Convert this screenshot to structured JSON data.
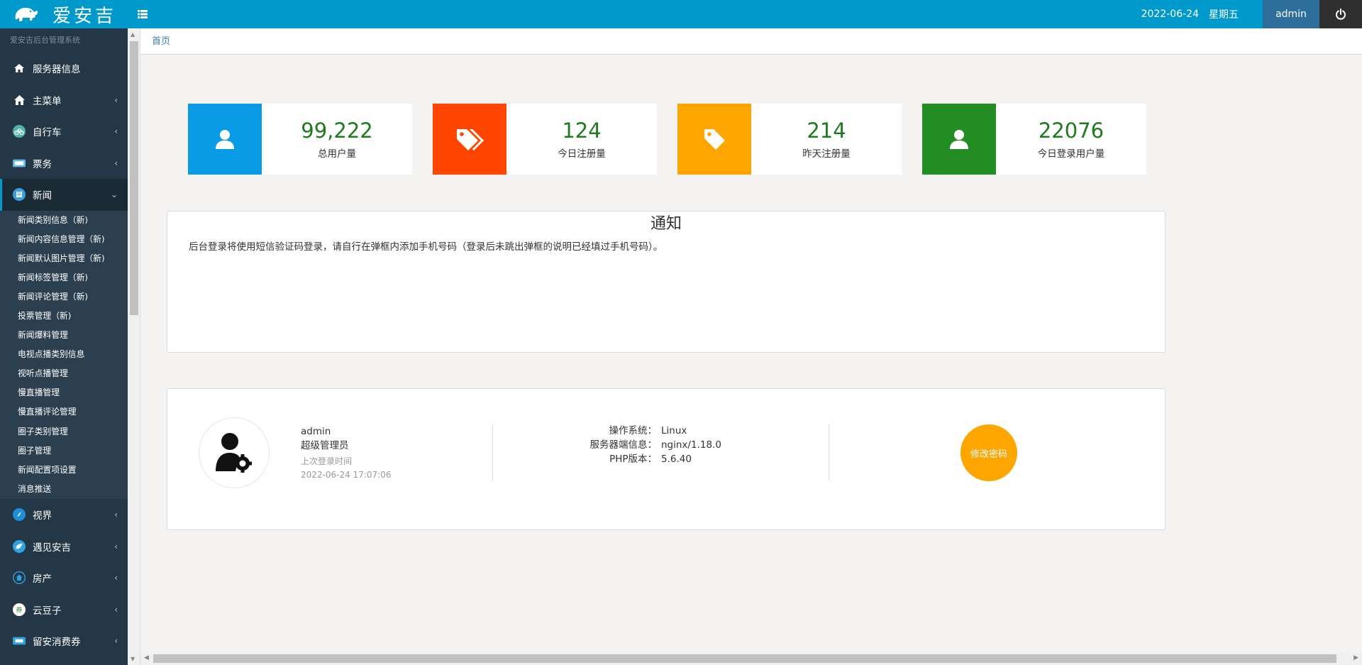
{
  "brand": {
    "name": "爱安吉"
  },
  "topbar": {
    "date": "2022-06-24",
    "weekday": "星期五",
    "user": "admin"
  },
  "sidebar": {
    "title": "爱安吉后台管理系统",
    "items": [
      {
        "label": "服务器信息",
        "icon": "home-icon"
      },
      {
        "label": "主菜单",
        "icon": "house-icon"
      },
      {
        "label": "自行车",
        "icon": "bicycle-icon"
      },
      {
        "label": "票务",
        "icon": "ticket-icon"
      },
      {
        "label": "新闻",
        "icon": "news-icon"
      },
      {
        "label": "视界",
        "icon": "compass-icon"
      },
      {
        "label": "遇见安吉",
        "icon": "bird-icon"
      },
      {
        "label": "房产",
        "icon": "house-circle-icon"
      },
      {
        "label": "云豆子",
        "icon": "coupon-icon"
      },
      {
        "label": "留安消费券",
        "icon": "voucher-icon"
      }
    ],
    "news_sub": [
      "新闻类别信息（新)",
      "新闻内容信息管理（新)",
      "新闻默认图片管理（新)",
      "新闻标签管理（新)",
      "新闻评论管理（新)",
      "投票管理（新)",
      "新闻爆料管理",
      "电视点播类别信息",
      "视听点播管理",
      "慢直播管理",
      "慢直播评论管理",
      "圈子类别管理",
      "圈子管理",
      "新闻配置项设置",
      "消息推送"
    ]
  },
  "breadcrumb": {
    "home": "首页"
  },
  "stats": [
    {
      "value": "99,222",
      "label": "总用户量",
      "color": "#0a9be6",
      "icon": "user-icon"
    },
    {
      "value": "124",
      "label": "今日注册量",
      "color": "#ff4500",
      "icon": "tags-icon"
    },
    {
      "value": "214",
      "label": "昨天注册量",
      "color": "#ffa500",
      "icon": "tag-icon"
    },
    {
      "value": "22076",
      "label": "今日登录用户量",
      "color": "#238c23",
      "icon": "user-icon"
    }
  ],
  "notice": {
    "title": "通知",
    "text": "后台登录将使用短信验证码登录，请自行在弹框内添加手机号码（登录后未跳出弹框的说明已经填过手机号码）。"
  },
  "info": {
    "user_name": "admin",
    "user_role": "超级管理员",
    "last_login_label": "上次登录时间",
    "last_login_time": "2022-06-24 17:07:06",
    "server": [
      {
        "key": "操作系统：",
        "value": "Linux"
      },
      {
        "key": "服务器端信息：",
        "value": "nginx/1.18.0"
      },
      {
        "key": "PHP版本：",
        "value": "5.6.40"
      }
    ],
    "change_password": "修改密码"
  }
}
